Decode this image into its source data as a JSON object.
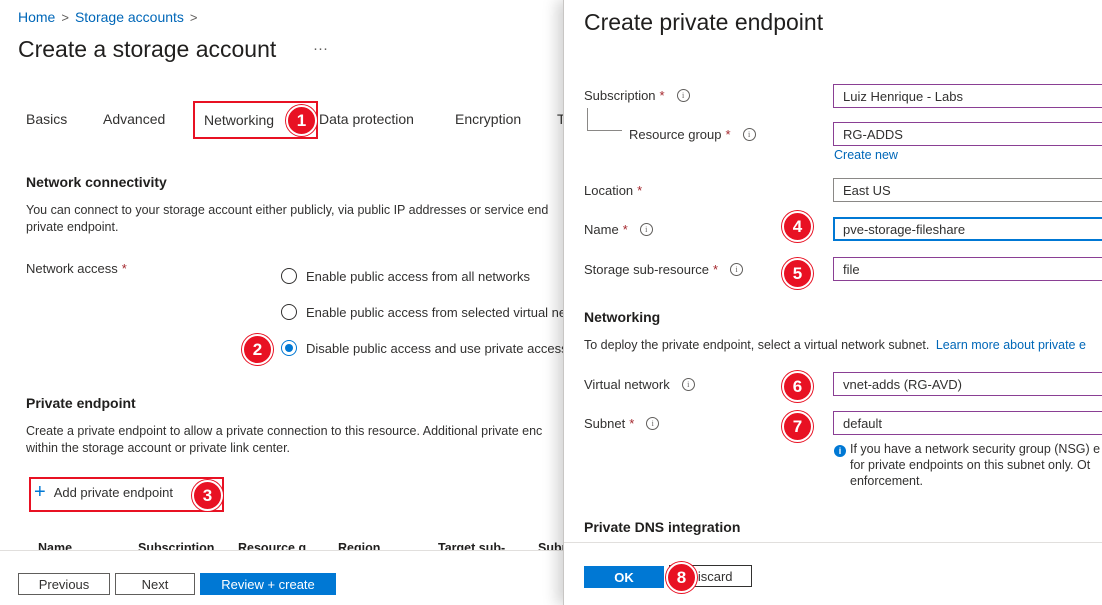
{
  "breadcrumb": {
    "home": "Home",
    "storage_accounts": "Storage accounts",
    "separator": ">"
  },
  "page": {
    "title": "Create a storage account",
    "more": "···"
  },
  "tabs": [
    {
      "label": "Basics"
    },
    {
      "label": "Advanced"
    },
    {
      "label": "Networking"
    },
    {
      "label": "Data protection"
    },
    {
      "label": "Encryption"
    },
    {
      "label": "T"
    }
  ],
  "network_connectivity": {
    "heading": "Network connectivity",
    "description_line1": "You can connect to your storage account either publicly, via public IP addresses or service end",
    "description_line2": "private endpoint.",
    "network_access_label": "Network access",
    "required_mark": "*",
    "options": [
      {
        "label": "Enable public access from all networks",
        "selected": false
      },
      {
        "label": "Enable public access from selected virtual net",
        "selected": false
      },
      {
        "label": "Disable public access and use private access",
        "selected": true
      }
    ]
  },
  "private_endpoint": {
    "heading": "Private endpoint",
    "description_line1": "Create a private endpoint to allow a private connection to this resource. Additional private enc",
    "description_line2": "within the storage account or private link center.",
    "add_button": "Add private endpoint",
    "add_icon": "+",
    "columns": [
      "Name",
      "Subscription",
      "Resource g",
      "Region",
      "Target sub-",
      "Subr"
    ]
  },
  "footer": {
    "previous": "Previous",
    "next": "Next",
    "review_create": "Review + create"
  },
  "blade": {
    "title": "Create private endpoint",
    "subscription": {
      "label": "Subscription",
      "value": "Luiz Henrique - Labs"
    },
    "resource_group": {
      "label": "Resource group",
      "value": "RG-ADDS",
      "create_new": "Create new"
    },
    "location": {
      "label": "Location",
      "value": "East US"
    },
    "name": {
      "label": "Name",
      "value": "pve-storage-fileshare"
    },
    "storage_subresource": {
      "label": "Storage sub-resource",
      "value": "file"
    },
    "networking": {
      "heading": "Networking",
      "description": "To deploy the private endpoint, select a virtual network subnet.",
      "learn_more": "Learn more about private e"
    },
    "virtual_network": {
      "label": "Virtual network",
      "value": "vnet-adds (RG-AVD)"
    },
    "subnet": {
      "label": "Subnet",
      "value": "default"
    },
    "nsg_note": {
      "line1": "If you have a network security group (NSG) e",
      "line2": "for private endpoints on this subnet only. Ot",
      "line3": "enforcement."
    },
    "dns_heading": "Private DNS integration",
    "ok": "OK",
    "discard": "Discard",
    "required_mark": "*",
    "info_glyph": "i"
  },
  "callouts": [
    "1",
    "2",
    "3",
    "4",
    "5",
    "6",
    "7",
    "8"
  ],
  "colors": {
    "accent": "#0078d4",
    "callout": "#e81123",
    "required": "#a4262c",
    "link": "#0067b8"
  },
  "icons": {
    "chevron_right": "chevron-right-icon",
    "info": "info-icon",
    "add": "plus-icon",
    "radio": "radio-button"
  }
}
